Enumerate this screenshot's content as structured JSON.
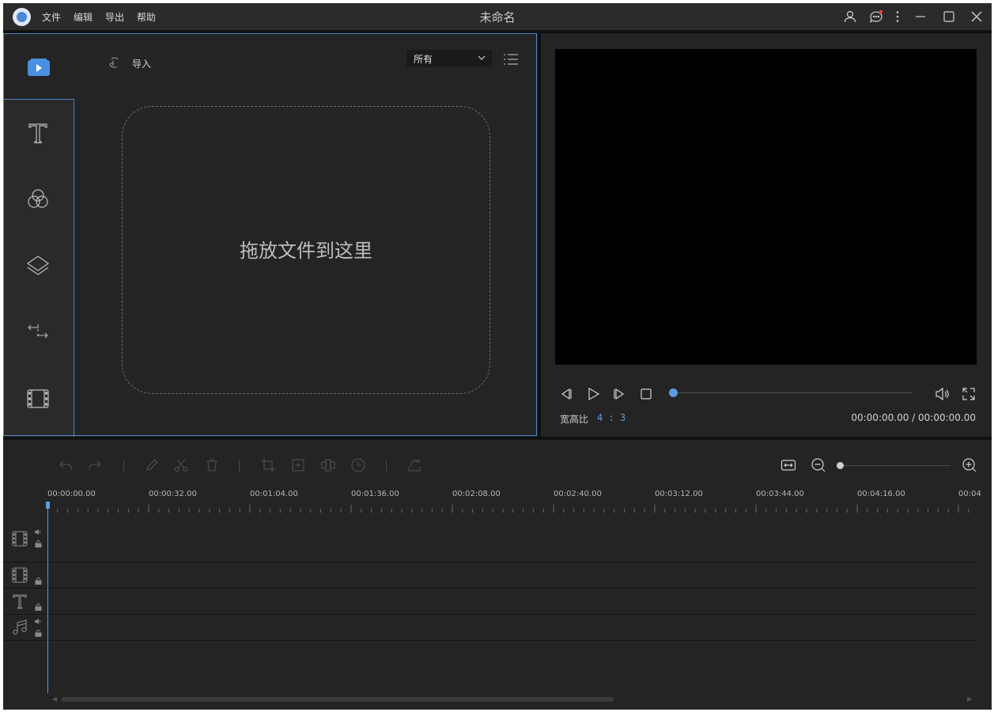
{
  "titlebar": {
    "title": "未命名",
    "menu": [
      "文件",
      "编辑",
      "导出",
      "帮助"
    ],
    "icons": [
      "user-icon",
      "feedback-icon",
      "more-icon",
      "minimize-icon",
      "maximize-icon",
      "close-icon"
    ],
    "notification_color": "#e83b3b"
  },
  "media_panel": {
    "import_label": "导入",
    "filter_selected": "所有",
    "drop_text": "拖放文件到这里",
    "side_tabs": [
      "media-icon",
      "text-icon",
      "filter-icon",
      "overlay-icon",
      "transition-icon",
      "element-icon"
    ]
  },
  "preview": {
    "aspect_ratio_label": "宽高比",
    "aspect_ratio_value": "4 : 3",
    "timecode": "00:00:00.00 / 00:00:00.00",
    "progress": 0
  },
  "timeline": {
    "ruler_labels": [
      "00:00:00.00",
      "00:00:32.00",
      "00:01:04.00",
      "00:01:36.00",
      "00:02:08.00",
      "00:02:40.00",
      "00:03:12.00",
      "00:03:44.00",
      "00:04:16.00",
      "00:04"
    ],
    "zoom_level": 0,
    "tracks": [
      "video-track",
      "overlay-track",
      "text-track",
      "audio-track"
    ]
  },
  "colors": {
    "accent": "#5b9be0",
    "background": "#242424",
    "titlebar": "#2b2b2b"
  }
}
